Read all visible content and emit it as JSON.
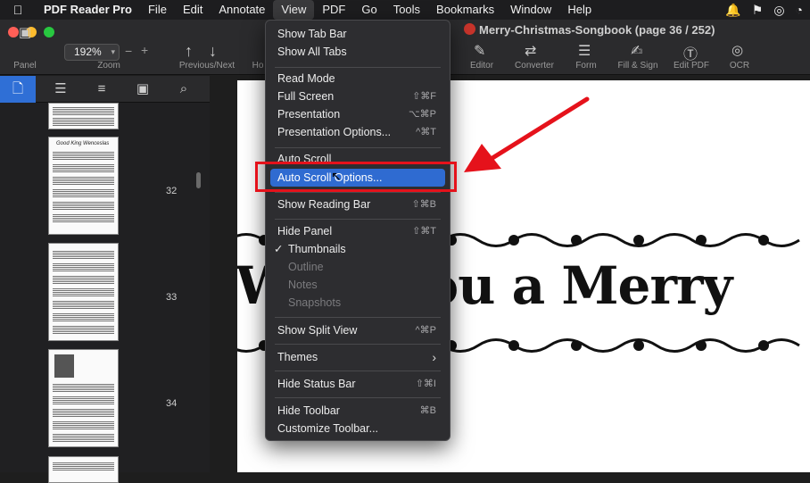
{
  "menubar": {
    "app_name": "PDF Reader Pro",
    "items": [
      "File",
      "Edit",
      "Annotate",
      "View",
      "PDF",
      "Go",
      "Tools",
      "Bookmarks",
      "Window",
      "Help"
    ],
    "active": "View"
  },
  "window": {
    "title": "Merry-Christmas-Songbook (page 36 / 252)"
  },
  "toolbar": {
    "panel_label": "Panel",
    "zoom_value": "192%",
    "zoom_label": "Zoom",
    "zoom_minus": "−",
    "zoom_plus": "+",
    "prevnext_label": "Previous/Next",
    "home_label": "Ho",
    "editor_label": "Editor",
    "converter_label": "Converter",
    "form_label": "Form",
    "fillsign_label": "Fill & Sign",
    "editpdf_label": "Edit PDF",
    "ocr_label": "OCR"
  },
  "sidebar": {
    "page_numbers": [
      "32",
      "33",
      "34"
    ],
    "thumb_titles": [
      "Good King Wenceslas"
    ]
  },
  "document": {
    "visible_text": "Wish You a Merry"
  },
  "view_menu": {
    "items": [
      {
        "label": "Show Tab Bar",
        "shortcut": ""
      },
      {
        "label": "Show All Tabs",
        "shortcut": ""
      },
      {
        "label": "Read Mode",
        "shortcut": ""
      },
      {
        "label": "Full Screen",
        "shortcut": "⇧⌘F"
      },
      {
        "label": "Presentation",
        "shortcut": "⌥⌘P"
      },
      {
        "label": "Presentation Options...",
        "shortcut": "^⌘T"
      },
      {
        "label": "Auto Scroll",
        "shortcut": ""
      },
      {
        "label": "Auto Scroll Options...",
        "shortcut": ""
      },
      {
        "label": "Show Reading Bar",
        "shortcut": "⇧⌘B"
      },
      {
        "label": "Hide Panel",
        "shortcut": "⇧⌘T"
      },
      {
        "label": "Thumbnails",
        "shortcut": ""
      },
      {
        "label": "Outline",
        "shortcut": ""
      },
      {
        "label": "Notes",
        "shortcut": ""
      },
      {
        "label": "Snapshots",
        "shortcut": ""
      },
      {
        "label": "Show Split View",
        "shortcut": "^⌘P"
      },
      {
        "label": "Themes",
        "shortcut": "›"
      },
      {
        "label": "Hide Status Bar",
        "shortcut": "⇧⌘I"
      },
      {
        "label": "Hide Toolbar",
        "shortcut": "⌘B"
      },
      {
        "label": "Customize Toolbar...",
        "shortcut": ""
      }
    ],
    "checked_item": "Thumbnails",
    "highlighted_item": "Auto Scroll Options..."
  },
  "colors": {
    "highlight": "#2f6bd1",
    "annotation_red": "#e5121b",
    "traffic_red": "#ff5f57",
    "traffic_yellow": "#febc2e",
    "traffic_green": "#28c840"
  }
}
